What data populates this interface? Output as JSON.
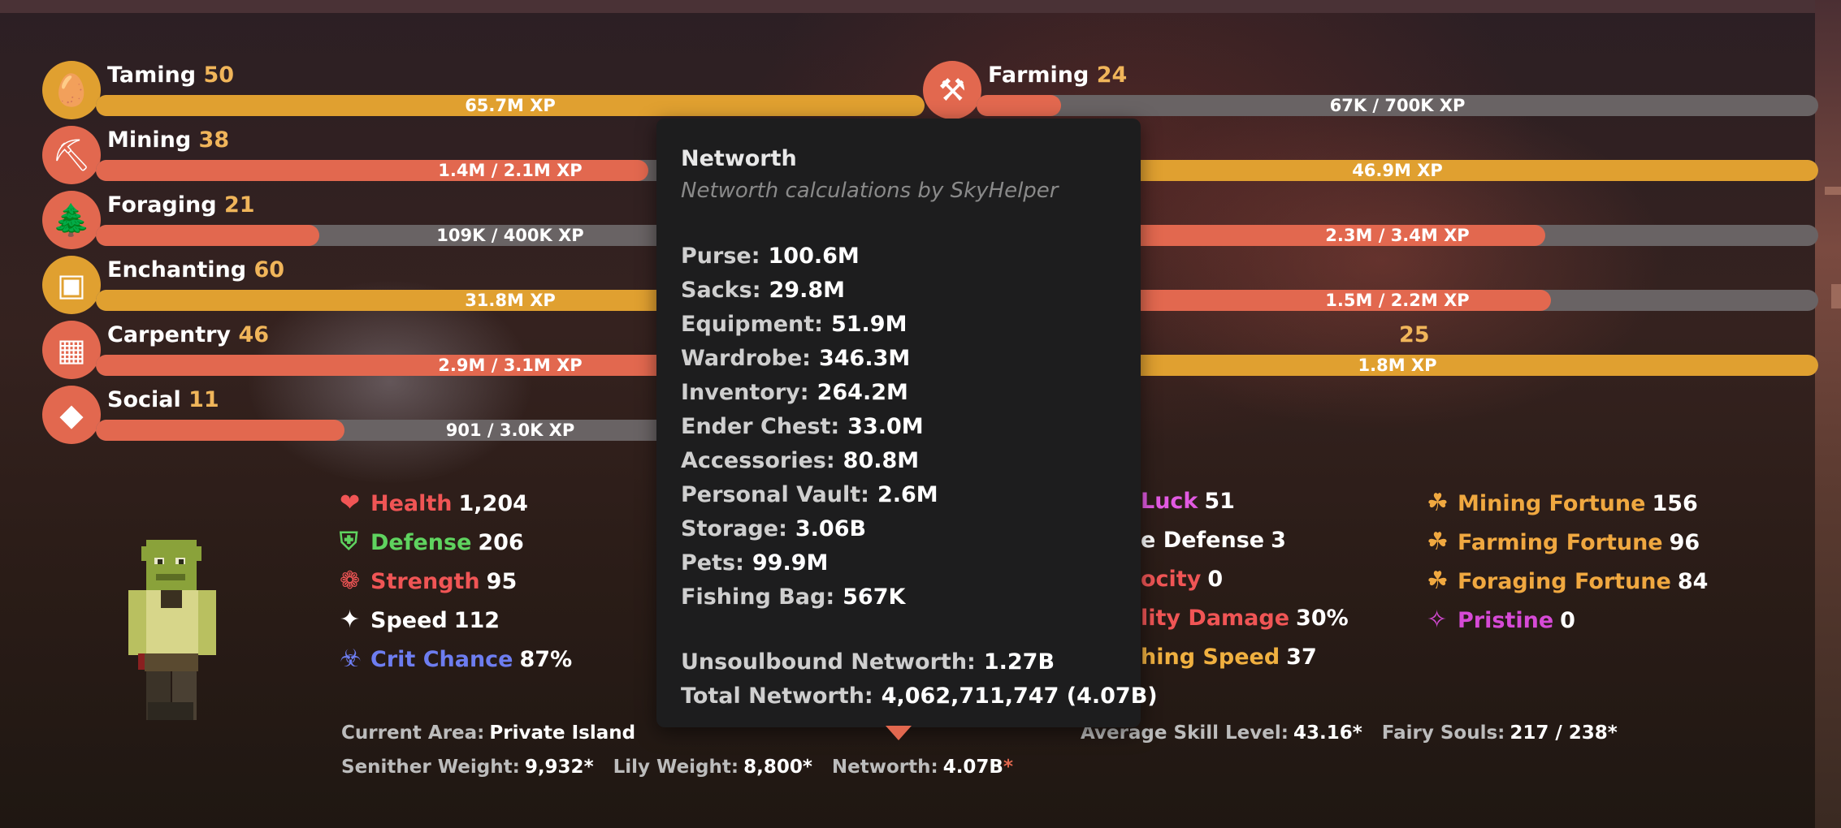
{
  "skills_left": [
    {
      "name": "Taming",
      "level": "50",
      "xp": "65.7M XP",
      "progress": 1.0,
      "icon": "spawn-egg-icon",
      "color": "gold"
    },
    {
      "name": "Mining",
      "level": "38",
      "xp": "1.4M / 2.1M XP",
      "progress": 0.667,
      "icon": "pickaxe-icon",
      "color": "red"
    },
    {
      "name": "Foraging",
      "level": "21",
      "xp": "109K / 400K XP",
      "progress": 0.27,
      "icon": "sapling-icon",
      "color": "red"
    },
    {
      "name": "Enchanting",
      "level": "60",
      "xp": "31.8M XP",
      "progress": 1.0,
      "icon": "enchanting-table-icon",
      "color": "gold"
    },
    {
      "name": "Carpentry",
      "level": "46",
      "xp": "2.9M / 3.1M XP",
      "progress": 0.935,
      "icon": "crafting-table-icon",
      "color": "red"
    },
    {
      "name": "Social",
      "level": "11",
      "xp": "901 / 3.0K XP",
      "progress": 0.3,
      "icon": "emerald-icon",
      "color": "red"
    }
  ],
  "skills_right": [
    {
      "name": "Farming",
      "level": "24",
      "xp": "67K / 700K XP",
      "progress": 0.1,
      "icon": "hoe-icon",
      "color": "red"
    },
    {
      "name": "",
      "level": "",
      "xp": "46.9M XP",
      "progress": 1.0,
      "icon": "",
      "color": "gold"
    },
    {
      "name": "",
      "level": "",
      "xp": "2.3M / 3.4M XP",
      "progress": 0.676,
      "icon": "",
      "color": "red"
    },
    {
      "name": "",
      "level": "",
      "xp": "1.5M / 2.2M XP",
      "progress": 0.682,
      "icon": "",
      "color": "red"
    },
    {
      "name": "",
      "level": "25",
      "xp": "1.8M XP",
      "progress": 1.0,
      "icon": "",
      "color": "gold"
    }
  ],
  "stats_col1": [
    {
      "icon": "heart-icon",
      "glyph": "❤",
      "name": "Health",
      "value": "1,204",
      "color": "#f05555"
    },
    {
      "icon": "shield-icon",
      "glyph": "⛨",
      "name": "Defense",
      "value": "206",
      "color": "#5fd35f"
    },
    {
      "icon": "strength-icon",
      "glyph": "❁",
      "name": "Strength",
      "value": "95",
      "color": "#f05555"
    },
    {
      "icon": "speed-icon",
      "glyph": "✦",
      "name": "Speed",
      "value": "112",
      "color": "#ffffff"
    },
    {
      "icon": "crit-chance-icon",
      "glyph": "☣",
      "name": "Crit Chance",
      "value": "87%",
      "color": "#6d7df0"
    }
  ],
  "stats_col2": [
    {
      "name": "Luck",
      "value": "51",
      "color": "#e25ae2"
    },
    {
      "name": "e Defense",
      "value": "3",
      "color": "#ffffff"
    },
    {
      "name": "ocity",
      "value": "0",
      "color": "#f05555"
    },
    {
      "name": "lity Damage",
      "value": "30%",
      "color": "#f05555"
    },
    {
      "name": "hing Speed",
      "value": "37",
      "color": "#f0b040"
    }
  ],
  "stats_col3": [
    {
      "icon": "clover-icon",
      "glyph": "☘",
      "name": "Mining Fortune",
      "value": "156",
      "color": "#f0a840"
    },
    {
      "icon": "clover-icon",
      "glyph": "☘",
      "name": "Farming Fortune",
      "value": "96",
      "color": "#f0a840"
    },
    {
      "icon": "clover-icon",
      "glyph": "☘",
      "name": "Foraging Fortune",
      "value": "84",
      "color": "#f0a840"
    },
    {
      "icon": "pristine-icon",
      "glyph": "✧",
      "name": "Pristine",
      "value": "0",
      "color": "#d64ad6"
    }
  ],
  "info_row1": [
    {
      "label": "Current Area:",
      "value": "Private Island"
    },
    {
      "label": "Average Skill Level:",
      "value": "43.16*"
    },
    {
      "label": "Fairy Souls:",
      "value": "217 / 238*"
    }
  ],
  "info_row2": [
    {
      "label": "Senither Weight:",
      "value": "9,932*"
    },
    {
      "label": "Lily Weight:",
      "value": "8,800*"
    },
    {
      "label": "Networth:",
      "value": "4.07B",
      "suffix": "*"
    }
  ],
  "tooltip": {
    "title": "Networth",
    "subtitle": "Networth calculations by SkyHelper",
    "rows": [
      {
        "label": "Purse:",
        "value": "100.6M"
      },
      {
        "label": "Sacks:",
        "value": "29.8M"
      },
      {
        "label": "Equipment:",
        "value": "51.9M"
      },
      {
        "label": "Wardrobe:",
        "value": "346.3M"
      },
      {
        "label": "Inventory:",
        "value": "264.2M"
      },
      {
        "label": "Ender Chest:",
        "value": "33.0M"
      },
      {
        "label": "Accessories:",
        "value": "80.8M"
      },
      {
        "label": "Personal Vault:",
        "value": "2.6M"
      },
      {
        "label": "Storage:",
        "value": "3.06B"
      },
      {
        "label": "Pets:",
        "value": "99.9M"
      },
      {
        "label": "Fishing Bag:",
        "value": "567K"
      }
    ],
    "totals": [
      {
        "label": "Unsoulbound Networth:",
        "value": "1.27B"
      },
      {
        "label": "Total Networth:",
        "value": "4,062,711,747 (4.07B)"
      }
    ]
  },
  "colors": {
    "gold": "#e0a030",
    "red": "#e2684f",
    "level": "#f0b55a",
    "track": "#696364"
  }
}
